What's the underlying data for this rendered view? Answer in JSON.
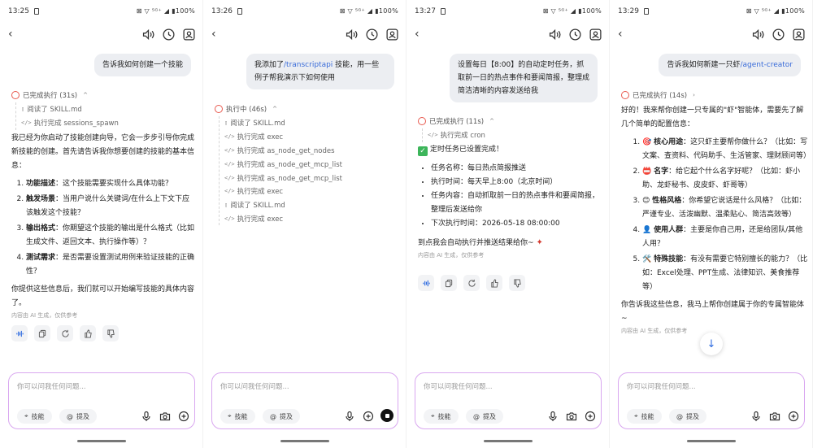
{
  "common": {
    "back_glyph": "‹",
    "signal": "⊠ ▽ ⁵ᴳ⁺ ◢ ▮100%",
    "input_placeholder": "你可以问我任何问题...",
    "chip_skill": "技能",
    "chip_mention": "提及",
    "ai_note": "内容由 AI 生成，仅供参考",
    "colors": {
      "accent": "#3a6cd9",
      "bubble_bg": "#eceef2",
      "input_border": "#d9a7f0",
      "exec_icon": "#e85a4f"
    }
  },
  "screens": [
    {
      "time": "13:25",
      "user_msg": "告诉我如何创建一个技能",
      "exec": {
        "label": "已完成执行 (31s)",
        "steps": [
          {
            "icon": "book-icon",
            "text": "阅读了 SKILL.md"
          },
          {
            "icon": "code-icon",
            "text": "执行完成 sessions_spawn"
          }
        ]
      },
      "intro": "我已经为你启动了技能创建向导，它会一步步引导你完成新技能的创建。首先请告诉我你想要创建的技能的基本信息：",
      "items": [
        {
          "title": "功能描述",
          "text": "：这个技能需要实现什么具体功能？"
        },
        {
          "title": "触发场景",
          "text": "：当用户说什么关键词/在什么上下文下应该触发这个技能？"
        },
        {
          "title": "输出格式",
          "text": "：你期望这个技能的输出是什么格式（比如生成文件、返回文本、执行操作等）？"
        },
        {
          "title": "测试需求",
          "text": "：是否需要设置测试用例来验证技能的正确性？"
        }
      ],
      "outro": "你提供这些信息后，我们就可以开始编写技能的具体内容了。"
    },
    {
      "time": "13:26",
      "user_msg_a": "我添加了",
      "user_msg_link": "/transcriptapi",
      "user_msg_b": " 技能，用一些例子帮我演示下如何使用",
      "exec": {
        "label": "执行中 (46s)",
        "steps": [
          {
            "icon": "book-icon",
            "text": "阅读了 SKILL.md"
          },
          {
            "icon": "code-icon",
            "text": "执行完成 exec"
          },
          {
            "icon": "code-icon",
            "text": "执行完成 as_node_get_nodes"
          },
          {
            "icon": "code-icon",
            "text": "执行完成 as_node_get_mcp_list"
          },
          {
            "icon": "code-icon",
            "text": "执行完成 as_node_get_mcp_list"
          },
          {
            "icon": "code-icon",
            "text": "执行完成 exec"
          },
          {
            "icon": "book-icon",
            "text": "阅读了 SKILL.md"
          },
          {
            "icon": "code-icon",
            "text": "执行完成 exec"
          }
        ]
      }
    },
    {
      "time": "13:27",
      "user_msg": "设置每日【8:00】的自动定时任务，抓取前一日的热点事件和要闻简报，整理成简洁清晰的内容发送给我",
      "exec": {
        "label": "已完成执行 (11s)",
        "steps": [
          {
            "icon": "code-icon",
            "text": "执行完成 cron"
          }
        ]
      },
      "heading": "定时任务已设置完成！",
      "bullets": [
        "任务名称：每日热点简报推送",
        "执行时间：每天早上8:00（北京时间）",
        "任务内容：自动抓取前一日的热点事件和要闻简报，整理后发送给你",
        "下次执行时间：2026-05-18 08:00:00"
      ],
      "outro": "到点我会自动执行并推送结果给你~"
    },
    {
      "time": "13:29",
      "user_msg_a": "告诉我如何新建一只虾",
      "user_msg_link": "/agent-creator",
      "exec": {
        "label": "已完成执行 (14s)",
        "steps": []
      },
      "intro": "好的！我来帮你创建一只专属的\"虾\"智能体，需要先了解几个简单的配置信息：",
      "items": [
        {
          "emoji": "🎯",
          "title": "核心用途",
          "text": "：这只虾主要帮你做什么？（比如：写文案、查资料、代码助手、生活管家、理财顾问等）"
        },
        {
          "emoji": "📛",
          "title": "名字",
          "text": "：给它起个什么名字好呢？（比如：虾小助、龙虾秘书、皮皮虾、虾哥等）"
        },
        {
          "emoji": "😊",
          "title": "性格风格",
          "text": "：你希望它说话是什么风格？（比如：严谨专业、活泼幽默、温柔贴心、简洁高效等）"
        },
        {
          "emoji": "👤",
          "title": "使用人群",
          "text": "：主要是你自己用，还是给团队/其他人用？"
        },
        {
          "emoji": "🛠️",
          "title": "特殊技能",
          "text": "：有没有需要它特别擅长的能力？（比如：Excel处理、PPT生成、法律知识、美食推荐等）"
        }
      ],
      "outro": "你告诉我这些信息，我马上帮你创建属于你的专属智能体~"
    }
  ]
}
